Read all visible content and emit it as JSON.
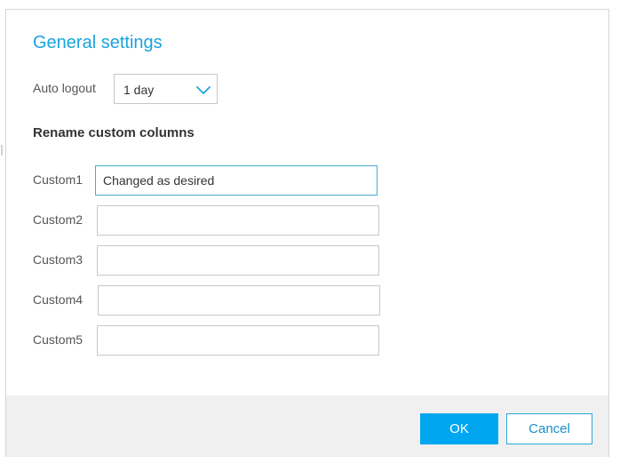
{
  "dialog": {
    "title": "General settings"
  },
  "auto_logout": {
    "label": "Auto logout",
    "selected": "1 day"
  },
  "rename_section": {
    "heading": "Rename custom columns",
    "fields": [
      {
        "label": "Custom1",
        "value": "Changed as desired"
      },
      {
        "label": "Custom2",
        "value": ""
      },
      {
        "label": "Custom3",
        "value": ""
      },
      {
        "label": "Custom4",
        "value": ""
      },
      {
        "label": "Custom5",
        "value": ""
      }
    ]
  },
  "footer": {
    "ok_label": "OK",
    "cancel_label": "Cancel"
  },
  "icons": {
    "dropdown": "chevron-down-icon"
  },
  "colors": {
    "accent": "#1aa3dd",
    "primary_button": "#00a6f0",
    "focus_border": "#4aa9c9",
    "footer_bg": "#f0f0f0"
  }
}
